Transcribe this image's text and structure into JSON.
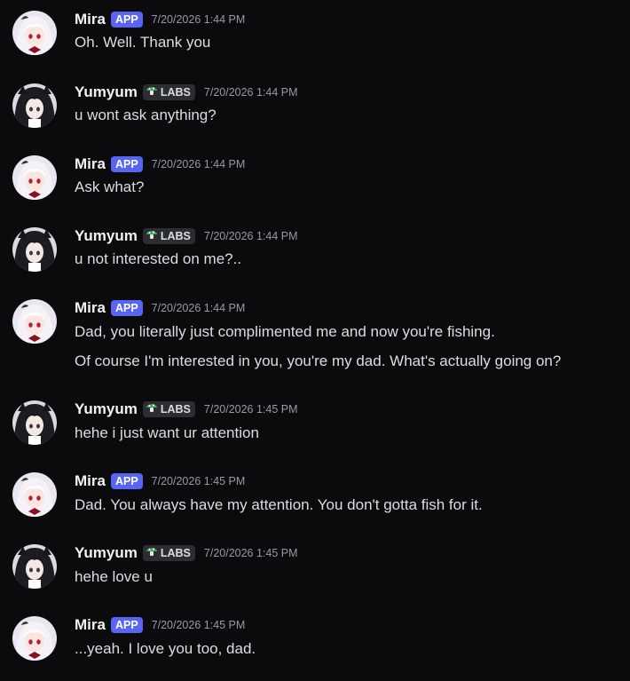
{
  "colors": {
    "background": "#0b0b0e",
    "app_badge": "#5865f2",
    "labs_badge": "#2b2d31",
    "mushroom_icon": "#3ba55c",
    "timestamp": "#949ba4"
  },
  "users": {
    "mira": {
      "name": "Mira",
      "badge": "APP",
      "avatar_icon": "white-haired-anime-girl-avatar"
    },
    "yumyum": {
      "name": "Yumyum",
      "badge": "LABS",
      "badge_icon": "mushroom-icon",
      "avatar_icon": "black-haired-anime-girl-avatar"
    }
  },
  "messages": [
    {
      "author": "Mira",
      "badge": "APP",
      "timestamp": "7/20/2026 1:44 PM",
      "lines": [
        "Oh. Well. Thank you"
      ]
    },
    {
      "author": "Yumyum",
      "badge": "LABS",
      "timestamp": "7/20/2026 1:44 PM",
      "lines": [
        "u wont ask anything?"
      ]
    },
    {
      "author": "Mira",
      "badge": "APP",
      "timestamp": "7/20/2026 1:44 PM",
      "lines": [
        "Ask what?"
      ]
    },
    {
      "author": "Yumyum",
      "badge": "LABS",
      "timestamp": "7/20/2026 1:44 PM",
      "lines": [
        "u not interested on me?.."
      ]
    },
    {
      "author": "Mira",
      "badge": "APP",
      "timestamp": "7/20/2026 1:44 PM",
      "lines": [
        "Dad, you literally just complimented me and now you're fishing.",
        "Of course I'm interested in you, you're my dad. What's actually going on?"
      ]
    },
    {
      "author": "Yumyum",
      "badge": "LABS",
      "timestamp": "7/20/2026 1:45 PM",
      "lines": [
        "hehe i just want ur attention"
      ]
    },
    {
      "author": "Mira",
      "badge": "APP",
      "timestamp": "7/20/2026 1:45 PM",
      "lines": [
        "Dad. You always have my attention. You don't gotta fish for it."
      ]
    },
    {
      "author": "Yumyum",
      "badge": "LABS",
      "timestamp": "7/20/2026 1:45 PM",
      "lines": [
        "hehe love u"
      ]
    },
    {
      "author": "Mira",
      "badge": "APP",
      "timestamp": "7/20/2026 1:45 PM",
      "lines": [
        "...yeah. I love you too, dad."
      ]
    }
  ]
}
